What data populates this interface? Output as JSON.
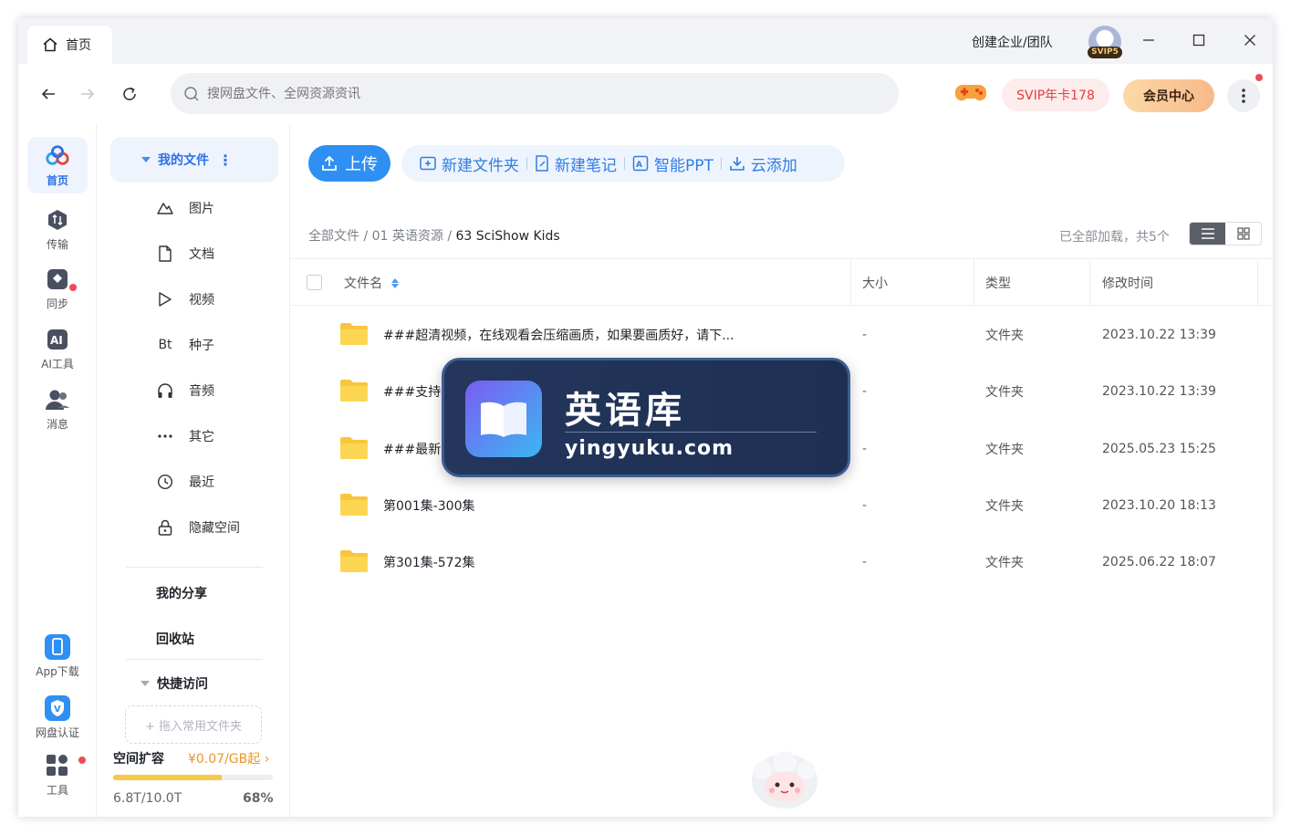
{
  "titlebar": {
    "tab_label": "首页",
    "create_org": "创建企业/团队",
    "avatar_badge": "SVIP5"
  },
  "navbar": {
    "search_placeholder": "搜网盘文件、全网资源资讯",
    "svip_offer": "SVIP年卡178",
    "vip_center": "会员中心"
  },
  "rail": {
    "items": [
      {
        "label": "首页",
        "icon": "home-cloud-icon",
        "active": true
      },
      {
        "label": "传输",
        "icon": "transfer-icon"
      },
      {
        "label": "同步",
        "icon": "sync-icon"
      },
      {
        "label": "AI工具",
        "icon": "ai-tools-icon"
      },
      {
        "label": "消息",
        "icon": "message-icon"
      }
    ],
    "bottom_items": [
      {
        "label": "App下载",
        "icon": "phone-icon"
      },
      {
        "label": "网盘认证",
        "icon": "verify-icon"
      },
      {
        "label": "工具",
        "icon": "tools-icon"
      }
    ]
  },
  "sidebar": {
    "my_files": "我的文件",
    "categories": [
      {
        "label": "图片",
        "icon": "image-icon"
      },
      {
        "label": "文档",
        "icon": "document-icon"
      },
      {
        "label": "视频",
        "icon": "video-icon"
      },
      {
        "label": "种子",
        "icon": "bt-icon",
        "glyph": "Bt"
      },
      {
        "label": "音频",
        "icon": "headphones-icon"
      },
      {
        "label": "其它",
        "icon": "more-dots-icon"
      },
      {
        "label": "最近",
        "icon": "clock-icon"
      },
      {
        "label": "隐藏空间",
        "icon": "lock-icon"
      }
    ],
    "my_share": "我的分享",
    "recycle": "回收站",
    "quick_access": "快捷访问",
    "drop_hint": "+ 拖入常用文件夹",
    "expand_label": "空间扩容",
    "expand_price": "¥0.07/GB起 ›",
    "quota_used": "6.8T/10.0T",
    "quota_percent": "68%",
    "quota_fraction": 0.68
  },
  "toolbar": {
    "upload": "上传",
    "new_folder": "新建文件夹",
    "new_note": "新建笔记",
    "smart_ppt": "智能PPT",
    "cloud_add": "云添加"
  },
  "breadcrumb": {
    "root": "全部文件",
    "sep": " / ",
    "level1": "01 英语资源",
    "current": "63 SciShow Kids"
  },
  "status": {
    "loaded": "已全部加载，共5个"
  },
  "table": {
    "headers": {
      "name": "文件名",
      "size": "大小",
      "type": "类型",
      "modified": "修改时间"
    },
    "rows": [
      {
        "name": "###超清视频，在线观看会压缩画质，如果要画质好，请下...",
        "size": "-",
        "type": "文件夹",
        "modified": "2023.10.22 13:39"
      },
      {
        "name": "###支持",
        "size": "-",
        "type": "文件夹",
        "modified": "2023.10.22 13:39"
      },
      {
        "name": "###最新",
        "size": "-",
        "type": "文件夹",
        "modified": "2025.05.23 15:25"
      },
      {
        "name": "第001集-300集",
        "size": "-",
        "type": "文件夹",
        "modified": "2023.10.20 18:13"
      },
      {
        "name": "第301集-572集",
        "size": "-",
        "type": "文件夹",
        "modified": "2025.06.22 18:07"
      }
    ]
  },
  "watermark": {
    "title": "英语库",
    "url": "yingyuku.com"
  },
  "colors": {
    "accent": "#2f8ff2",
    "folder": "#f8c63d",
    "vip": "#e83c3c"
  }
}
